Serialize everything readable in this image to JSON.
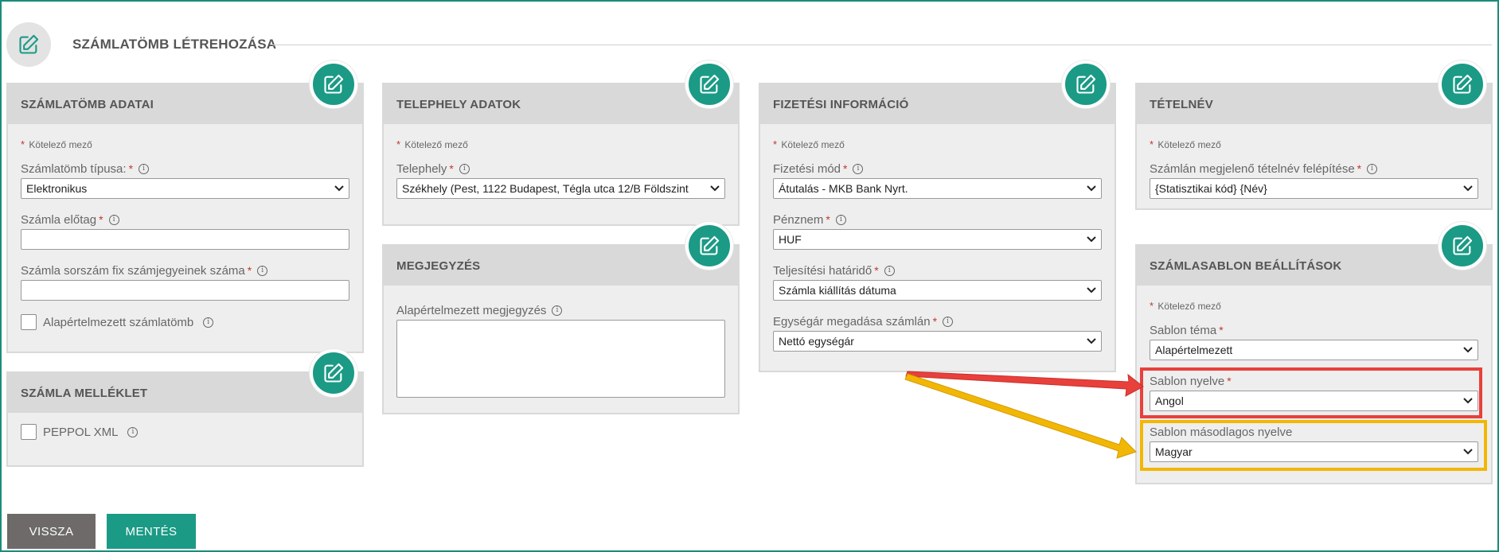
{
  "page": {
    "title": "SZÁMLATÖMB LÉTREHOZÁSA"
  },
  "required_note": "Kötelező mező",
  "cards": {
    "szamlatomb": {
      "title": "SZÁMLATÖMB ADATAI",
      "tipus_label": "Számlatömb típusa:",
      "tipus_value": "Elektronikus",
      "elotag_label": "Számla előtag",
      "elotag_value": "",
      "fix_label": "Számla sorszám fix számjegyeinek száma",
      "fix_value": "",
      "default_label": "Alapértelmezett számlatömb"
    },
    "melleklet": {
      "title": "SZÁMLA MELLÉKLET",
      "peppol_label": "PEPPOL XML"
    },
    "telephely": {
      "title": "TELEPHELY ADATOK",
      "telephely_label": "Telephely",
      "telephely_value": "Székhely (Pest, 1122 Budapest, Tégla utca 12/B Földszint"
    },
    "megjegyzes": {
      "title": "MEGJEGYZÉS",
      "label": "Alapértelmezett megjegyzés",
      "value": ""
    },
    "fizetesi": {
      "title": "FIZETÉSI INFORMÁCIÓ",
      "mod_label": "Fizetési mód",
      "mod_value": "Átutalás - MKB Bank Nyrt.",
      "penznem_label": "Pénznem",
      "penznem_value": "HUF",
      "hatarido_label": "Teljesítési határidő",
      "hatarido_value": "Számla kiállítás dátuma",
      "egysegar_label": "Egységár megadása számlán",
      "egysegar_value": "Nettó egységár"
    },
    "tetelnev": {
      "title": "TÉTELNÉV",
      "label": "Számlán megjelenő tételnév felépítése",
      "value": "{Statisztikai kód} {Név}"
    },
    "sablon": {
      "title": "SZÁMLASABLON BEÁLLÍTÁSOK",
      "tema_label": "Sablon téma",
      "tema_value": "Alapértelmezett",
      "nyelv_label": "Sablon nyelve",
      "nyelv_value": "Angol",
      "masodlagos_label": "Sablon másodlagos nyelve",
      "masodlagos_value": "Magyar"
    }
  },
  "buttons": {
    "back": "VISSZA",
    "save": "MENTÉS"
  },
  "colors": {
    "accent": "#1b9a86",
    "highlight_red": "#e8403b",
    "highlight_yellow": "#f2b705",
    "back_button": "#6e6a6a"
  },
  "icons": {
    "edit": "edit-icon",
    "chevron": "chevron-down-icon",
    "info": "info-icon"
  }
}
